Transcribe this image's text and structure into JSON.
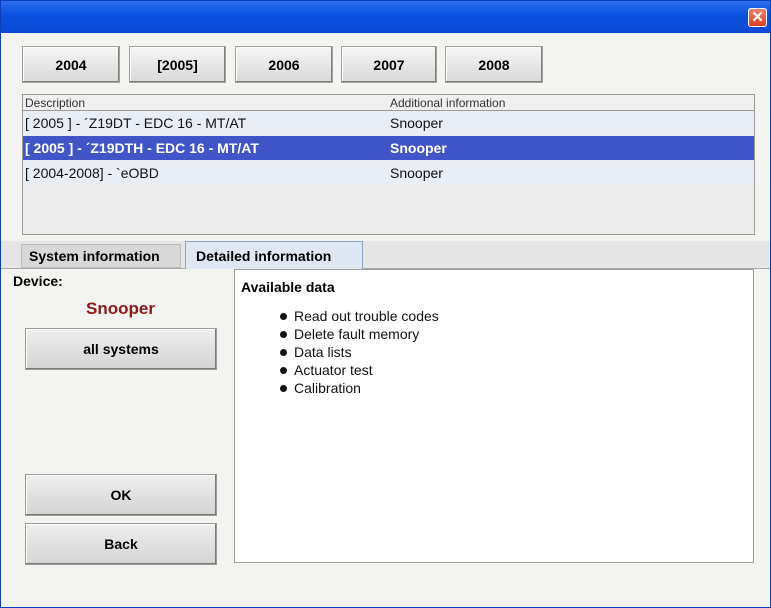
{
  "titlebar": {
    "close_glyph": "✕"
  },
  "years": [
    "2004",
    "[2005]",
    "2006",
    "2007",
    "2008"
  ],
  "vehicle_list": {
    "columns": [
      "Description",
      "Additional information"
    ],
    "rows": [
      {
        "description": "[ 2005 ] - ´Z19DT - EDC 16 - MT/AT",
        "info": "Snooper",
        "selected": false
      },
      {
        "description": "[ 2005 ] - ´Z19DTH - EDC 16 - MT/AT",
        "info": "Snooper",
        "selected": true
      },
      {
        "description": "[ 2004-2008] - `eOBD",
        "info": "Snooper",
        "selected": false
      }
    ]
  },
  "tabs": [
    "System information",
    "Detailed information"
  ],
  "device": {
    "label": "Device:",
    "name": "Snooper"
  },
  "buttons": {
    "all_systems": "all systems",
    "ok": "OK",
    "back": "Back"
  },
  "detail": {
    "title": "Available data",
    "features": [
      "Read out trouble codes",
      "Delete fault memory",
      "Data lists",
      "Actuator test",
      "Calibration"
    ]
  },
  "colors": {
    "selection": "#3f55c8",
    "titlebar": "#0a52e0",
    "device_name": "#8b1a1a"
  }
}
